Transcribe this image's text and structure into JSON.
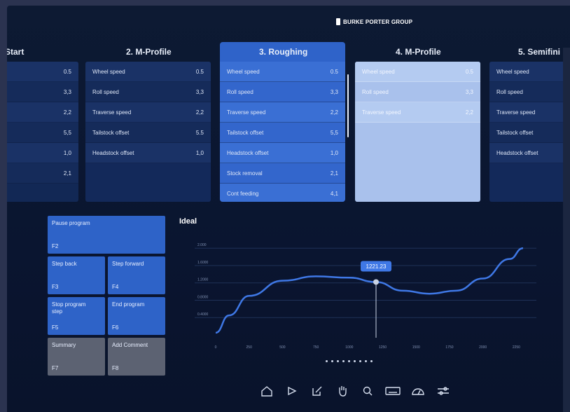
{
  "brand": "BURKE PORTER GROUP",
  "steps": [
    {
      "title": "Start",
      "rows": [
        {
          "label": "",
          "value": "0.5"
        },
        {
          "label": "",
          "value": "3,3"
        },
        {
          "label": "",
          "value": "2,2"
        },
        {
          "label": "",
          "value": "5,5"
        },
        {
          "label": "",
          "value": "1,0"
        },
        {
          "label": "",
          "value": "2,1"
        }
      ]
    },
    {
      "title": "2. M-Profile",
      "rows": [
        {
          "label": "Wheel speed",
          "value": "0.5"
        },
        {
          "label": "Roll speed",
          "value": "3,3"
        },
        {
          "label": "Traverse speed",
          "value": "2,2"
        },
        {
          "label": "Tailstock offset",
          "value": "5.5"
        },
        {
          "label": "Headstock offset",
          "value": "1,0"
        }
      ]
    },
    {
      "title": "3. Roughing",
      "rows": [
        {
          "label": "Wheel speed",
          "value": "0.5"
        },
        {
          "label": "Roll speed",
          "value": "3,3"
        },
        {
          "label": "Traverse speed",
          "value": "2,2"
        },
        {
          "label": "Tailstock offset",
          "value": "5,5"
        },
        {
          "label": "Headstock offset",
          "value": "1,0"
        },
        {
          "label": "Stock removal",
          "value": "2,1"
        },
        {
          "label": "Cont feeding",
          "value": "4,1"
        }
      ]
    },
    {
      "title": "4. M-Profile",
      "rows": [
        {
          "label": "Wheel speed",
          "value": "0.5"
        },
        {
          "label": "Roll speed",
          "value": "3,3"
        },
        {
          "label": "Traverse speed",
          "value": "2,2"
        }
      ]
    },
    {
      "title": "5. Semifini",
      "rows": [
        {
          "label": "Wheel speed",
          "value": ""
        },
        {
          "label": "Roll speed",
          "value": ""
        },
        {
          "label": "Traverse speed",
          "value": ""
        },
        {
          "label": "Tailstock offset",
          "value": ""
        },
        {
          "label": "Headstock offset",
          "value": ""
        }
      ]
    }
  ],
  "controls": {
    "pause": {
      "label": "Pause program",
      "key": "F2"
    },
    "step_back": {
      "label": "Step back",
      "key": "F3"
    },
    "step_forward": {
      "label": "Step forward",
      "key": "F4"
    },
    "stop_step": {
      "label": "Stop program step",
      "key": "F5"
    },
    "end_program": {
      "label": "End program",
      "key": "F6"
    },
    "summary": {
      "label": "Summary",
      "key": "F7"
    },
    "add_comment": {
      "label": "Add Comment",
      "key": "F8"
    }
  },
  "chart_data": {
    "type": "line",
    "title": "Ideal",
    "x_ticks": [
      "0",
      "250",
      "500",
      "750",
      "1000",
      "1250",
      "1500",
      "1750",
      "2000",
      "2250"
    ],
    "y_ticks": [
      "0.4000",
      "0.8000",
      "1.2000",
      "1.6000",
      "2.000"
    ],
    "xlim": [
      0,
      2400
    ],
    "ylim": [
      0,
      2.1
    ],
    "series": [
      {
        "x": [
          0,
          100,
          250,
          500,
          750,
          1000,
          1200,
          1400,
          1600,
          1800,
          2000,
          2200,
          2300
        ],
        "y": [
          0.05,
          0.45,
          0.9,
          1.25,
          1.35,
          1.32,
          1.22,
          1.02,
          0.95,
          1.02,
          1.3,
          1.75,
          2.0
        ]
      }
    ],
    "highlight": {
      "x": 1200,
      "y": 1.22,
      "label": "1221.23"
    },
    "grid": true
  },
  "pager": {
    "count": 9,
    "active": 0
  },
  "toolbar": [
    "home-icon",
    "play-icon",
    "edit-icon",
    "hand-icon",
    "search-icon",
    "keyboard-icon",
    "gauge-icon",
    "settings-icon"
  ]
}
